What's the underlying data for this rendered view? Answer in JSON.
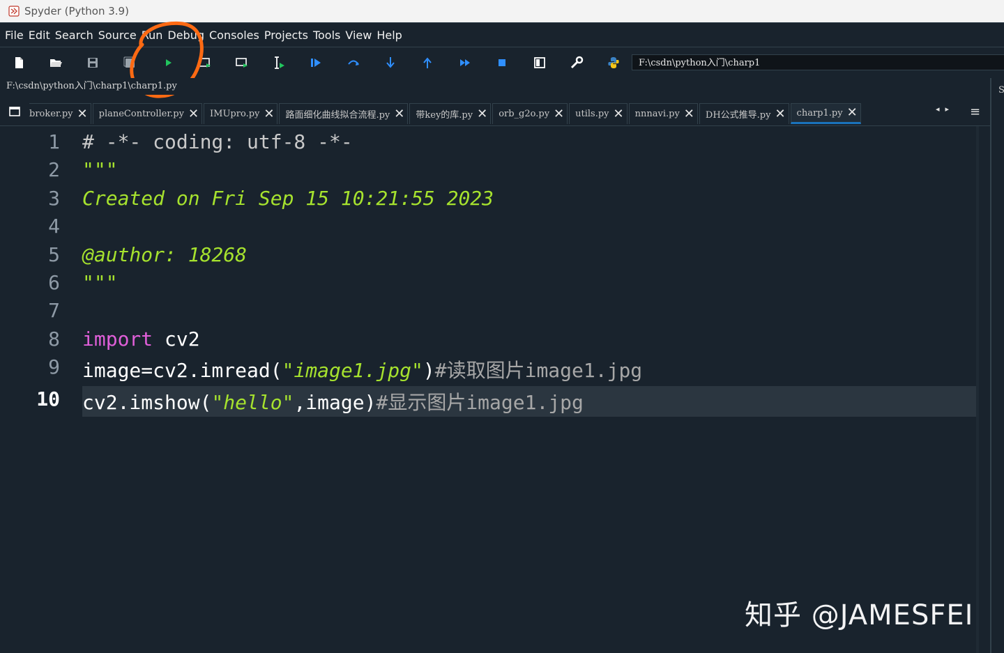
{
  "window": {
    "title": "Spyder (Python 3.9)",
    "app_icon": "spyder-icon"
  },
  "menu": [
    "File",
    "Edit",
    "Search",
    "Source",
    "Run",
    "Debug",
    "Consoles",
    "Projects",
    "Tools",
    "View",
    "Help"
  ],
  "toolbar": {
    "icons": [
      "new-file-icon",
      "open-file-icon",
      "save-icon",
      "save-all-icon",
      "run-icon",
      "run-cell-icon",
      "run-cell-advance-icon",
      "run-selection-icon",
      "debug-icon",
      "step-over-icon",
      "step-into-icon",
      "step-return-icon",
      "continue-icon",
      "stop-icon",
      "maximize-pane-icon",
      "preferences-icon",
      "python-path-icon"
    ],
    "working_dir": "F:\\csdn\\python入门\\charp1"
  },
  "editor": {
    "file_path": "F:\\csdn\\python入门\\charp1\\charp1.py",
    "tabs": [
      {
        "label": "broker.py",
        "active": false
      },
      {
        "label": "planeController.py",
        "active": false
      },
      {
        "label": "IMUpro.py",
        "active": false
      },
      {
        "label": "路面细化曲线拟合流程.py",
        "active": false
      },
      {
        "label": "带key的库.py",
        "active": false
      },
      {
        "label": "orb_g2o.py",
        "active": false
      },
      {
        "label": "utils.py",
        "active": false
      },
      {
        "label": "nnnavi.py",
        "active": false
      },
      {
        "label": "DH公式推导.py",
        "active": false
      },
      {
        "label": "charp1.py",
        "active": true
      }
    ],
    "current_line": "10",
    "line_numbers": [
      "1",
      "2",
      "3",
      "4",
      "5",
      "6",
      "7",
      "8",
      "9",
      "10"
    ],
    "lines": {
      "l1": "# -*- coding: utf-8 -*-",
      "l2": "\"\"\"",
      "l3": "Created on Fri Sep 15 10:21:55 2023",
      "l5": "@author: 18268",
      "l6": "\"\"\"",
      "l8_kw": "import",
      "l8_rest": " cv2",
      "l9_a": "image=cv2.imread(",
      "l9_str": "\"image1.jpg\"",
      "l9_b": ")",
      "l9_cmt": "#读取图片image1.jpg",
      "l10_a": "cv2.imshow(",
      "l10_str": "\"hello\"",
      "l10_b": ",image)",
      "l10_cmt": "#显示图片image1.jpg"
    }
  },
  "right_pane": {
    "label": "S"
  },
  "watermark": "知乎 @JAMESFEI",
  "colors": {
    "background": "#19232d",
    "accent": "#1a72bb",
    "annotation": "#ff6a13",
    "docstring": "#a6e22e",
    "keyword": "#e05fd9"
  }
}
